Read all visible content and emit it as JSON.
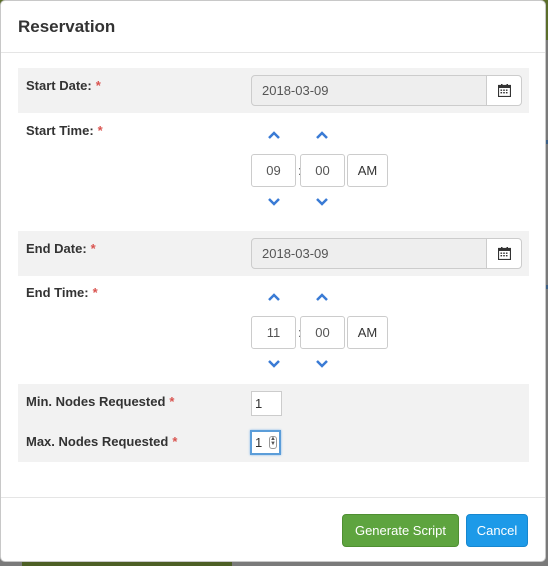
{
  "modal": {
    "title": "Reservation"
  },
  "form": {
    "required_marker": "*",
    "start_date": {
      "label": "Start Date:",
      "value": "2018-03-09"
    },
    "start_time": {
      "label": "Start Time:",
      "hour": "09",
      "minute": "00",
      "separator": ":",
      "meridian": "AM"
    },
    "end_date": {
      "label": "End Date:",
      "value": "2018-03-09"
    },
    "end_time": {
      "label": "End Time:",
      "hour": "11",
      "minute": "00",
      "separator": ":",
      "meridian": "AM"
    },
    "min_nodes": {
      "label": "Min. Nodes Requested",
      "value": "1"
    },
    "max_nodes": {
      "label": "Max. Nodes Requested",
      "value": "1"
    }
  },
  "footer": {
    "generate_label": "Generate Script",
    "cancel_label": "Cancel"
  },
  "colors": {
    "required": "#d9534f",
    "arrow": "#3a7bd5",
    "success": "#5ea43f",
    "primary": "#1d9ae8"
  },
  "icons": {
    "calendar": "calendar-icon",
    "up": "chevron-up-icon",
    "down": "chevron-down-icon"
  }
}
